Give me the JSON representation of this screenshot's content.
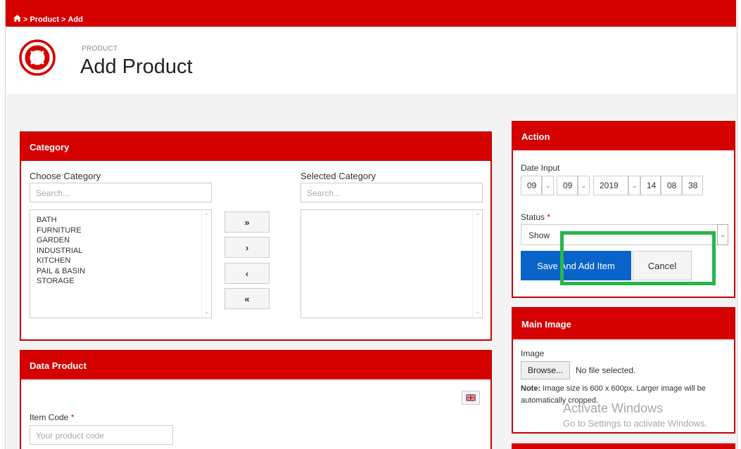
{
  "breadcrumb": {
    "home_icon": "home-icon",
    "separator": ">",
    "items": [
      "Product",
      "Add"
    ]
  },
  "header": {
    "logo_icon": "lifebuoy-icon",
    "subtitle": "PRODUCT",
    "title": "Add Product"
  },
  "category_panel": {
    "title": "Category",
    "choose_label": "Choose Category",
    "selected_label": "Selected Category",
    "search_placeholder": "Search...",
    "available_options": [
      "BATH",
      "FURNITURE",
      "GARDEN",
      "INDUSTRIAL",
      "KITCHEN",
      "PAIL & BASIN",
      "STORAGE"
    ],
    "selected_options": [],
    "buttons": {
      "move_all_right": "»",
      "move_right": "›",
      "move_left": "‹",
      "move_all_left": "«"
    }
  },
  "data_product_panel": {
    "title": "Data Product",
    "language_icon": "uk-flag-icon",
    "item_code_label": "Item Code",
    "required_mark": "*",
    "item_code_placeholder": "Your product code"
  },
  "action_panel": {
    "title": "Action",
    "date_label": "Date Input",
    "day": "09",
    "month": "09",
    "year": "2019",
    "hour": "14",
    "minute": "08",
    "second": "38",
    "status_label": "Status",
    "required_mark": "*",
    "status_value": "Show",
    "save_label": "Save And Add Item",
    "cancel_label": "Cancel"
  },
  "main_image_panel": {
    "title": "Main Image",
    "image_label": "Image",
    "browse_label": "Browse...",
    "file_status": "No file selected.",
    "note_label": "Note:",
    "note_text": "Image size is 600 x 600px. Larger image will be automatically cropped."
  },
  "watermark": {
    "line1": "Activate Windows",
    "line2": "Go to Settings to activate Windows."
  },
  "colors": {
    "brand_red": "#d50000",
    "primary_blue": "#0a63c9",
    "highlight_green": "#2ab44a"
  }
}
